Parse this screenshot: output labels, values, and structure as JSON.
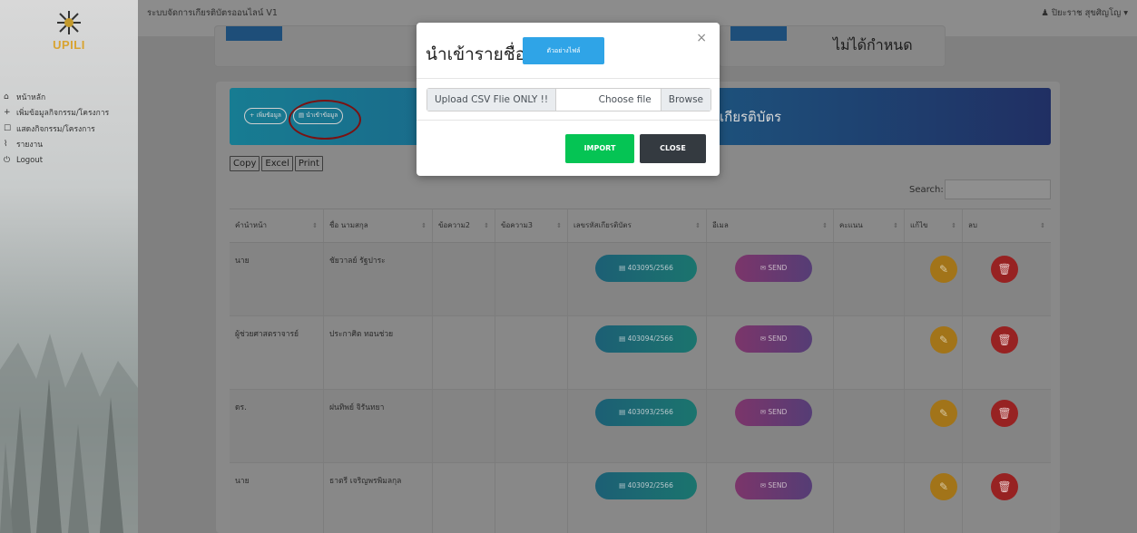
{
  "app": {
    "title": "ระบบจัดการเกียรติบัตรออนไลน์ V1",
    "user_name": "ปิยะราช สุขศิญโญ",
    "user_icon": "user-icon",
    "caret_icon": "caret-down-icon"
  },
  "logo": {
    "text": "UPILI"
  },
  "sidebar": {
    "items": [
      {
        "icon": "home-icon",
        "glyph": "⌂",
        "label": "หน้าหลัก"
      },
      {
        "icon": "plus-icon",
        "glyph": "+",
        "label": "เพิ่มข้อมูลกิจกรรม/โครงการ"
      },
      {
        "icon": "square-icon",
        "glyph": "☐",
        "label": "แสดงกิจกรรม/โครงการ"
      },
      {
        "icon": "chart-icon",
        "glyph": "⌇",
        "label": "รายงาน"
      },
      {
        "icon": "power-icon",
        "glyph": "⏻",
        "label": "Logout"
      }
    ]
  },
  "cards": {
    "status_text": "ไม่ได้กำหนด"
  },
  "banner": {
    "title": "เกียรติบัตร",
    "add_label": "+ เพิ่มข้อมูล",
    "import_label": "นำเข้าข้อมูล"
  },
  "toolbar": {
    "copy": "Copy",
    "excel": "Excel",
    "print": "Print",
    "search_label": "Search:"
  },
  "table": {
    "headers": [
      "คำนำหน้า",
      "ชื่อ นามสกุล",
      "ข้อความ2",
      "ข้อความ3",
      "เลขรหัสเกียรติบัตร",
      "อีเมล",
      "คะแนน",
      "แก้ไข",
      "ลบ"
    ],
    "send_label": "SEND",
    "rows": [
      {
        "prefix": "นาย",
        "name": "ชัยวาลย์ รัฐปาระ",
        "cert": "403095/2566"
      },
      {
        "prefix": "ผู้ช่วยศาสตราจารย์",
        "name": "ประกาศิต ทอนช่วย",
        "cert": "403094/2566"
      },
      {
        "prefix": "ดร.",
        "name": "ฝนทิพย์ จิรันทยา",
        "cert": "403093/2566"
      },
      {
        "prefix": "นาย",
        "name": "ธาตรี เจริญพรพิมลกุล",
        "cert": "403092/2566"
      }
    ]
  },
  "modal": {
    "title": "นำเข้ารายชื่อ",
    "sample_label": "ตัวอย่างไฟล์",
    "close_x": "×",
    "file_prepend": "Upload CSV Flie ONLY !!",
    "file_choose": "Choose file",
    "file_browse": "Browse",
    "import_label": "IMPORT",
    "close_label": "CLOSE"
  }
}
